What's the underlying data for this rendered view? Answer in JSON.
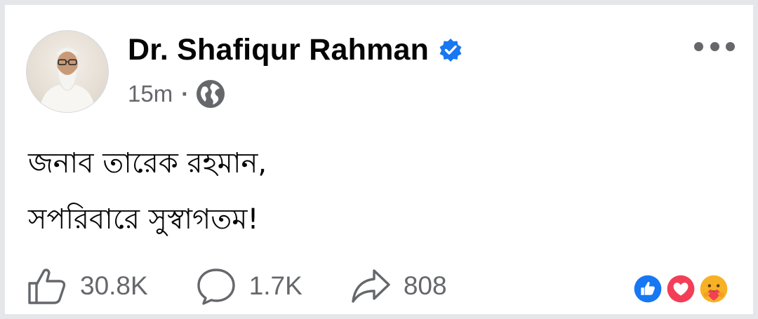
{
  "post": {
    "author_name": "Dr. Shafiqur Rahman",
    "verified_icon": "verified-badge-icon",
    "time": "15m",
    "separator": "·",
    "privacy_icon": "globe-icon",
    "text_lines": [
      "জনাব তারেক রহমান,",
      "সপরিবারে সুস্বাগতম!"
    ]
  },
  "actions": {
    "like_count": "30.8K",
    "comment_count": "1.7K",
    "share_count": "808"
  },
  "reactions": [
    "like-reaction-icon",
    "love-reaction-icon",
    "care-reaction-icon"
  ],
  "colors": {
    "accent": "#1877f2",
    "love": "#f33e58",
    "care": "#f7b125",
    "secondary_text": "#65676b",
    "primary_text": "#050505"
  }
}
